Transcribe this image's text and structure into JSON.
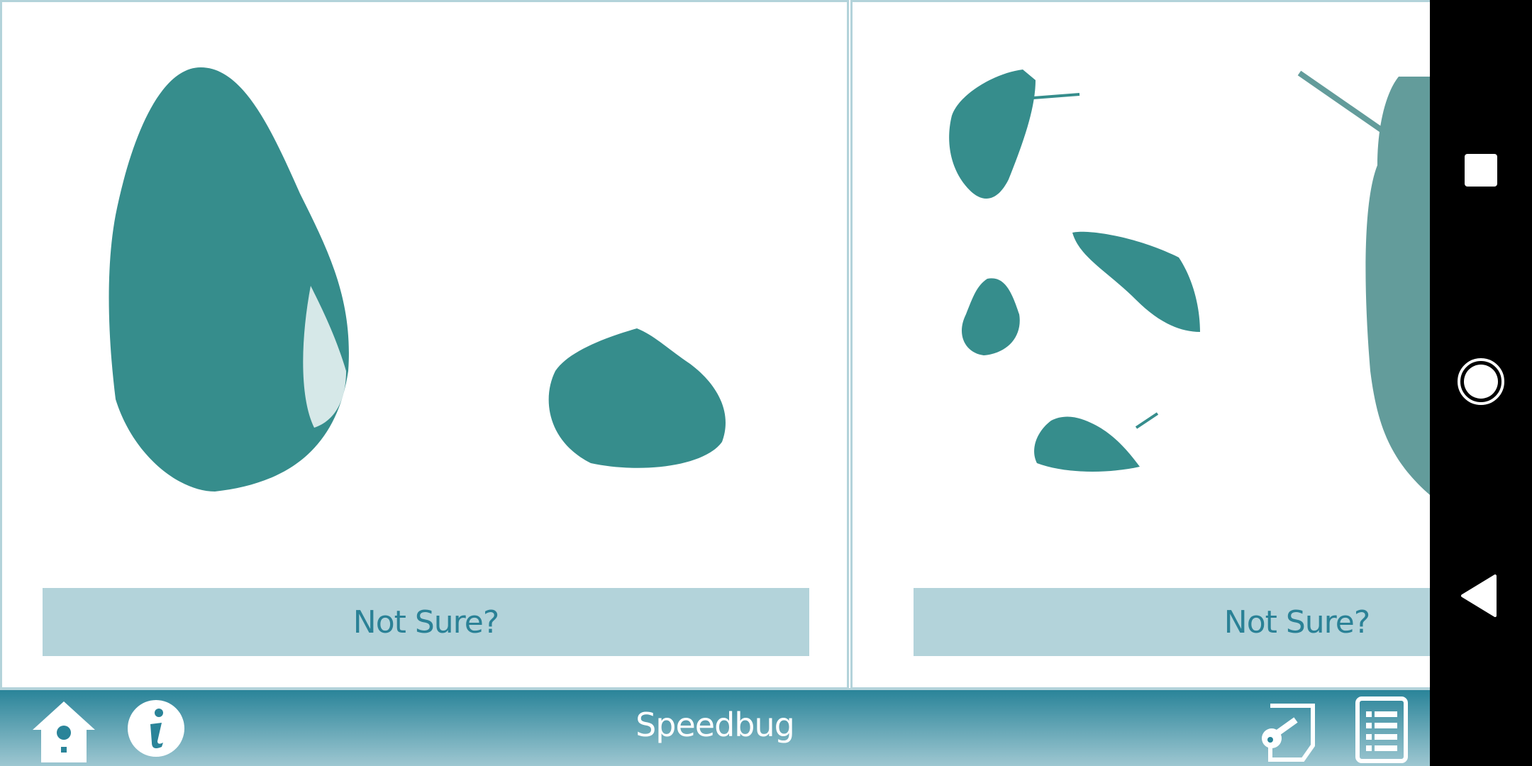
{
  "cards": [
    {
      "button_label": "Not Sure?"
    },
    {
      "button_label": "Not Sure?"
    }
  ],
  "bottom_bar": {
    "title": "Speedbug"
  },
  "colors": {
    "accent": "#2a8499",
    "panel": "#b3d3da",
    "silhouette": "#368d8c",
    "silhouette_faded": "#639c9b"
  }
}
